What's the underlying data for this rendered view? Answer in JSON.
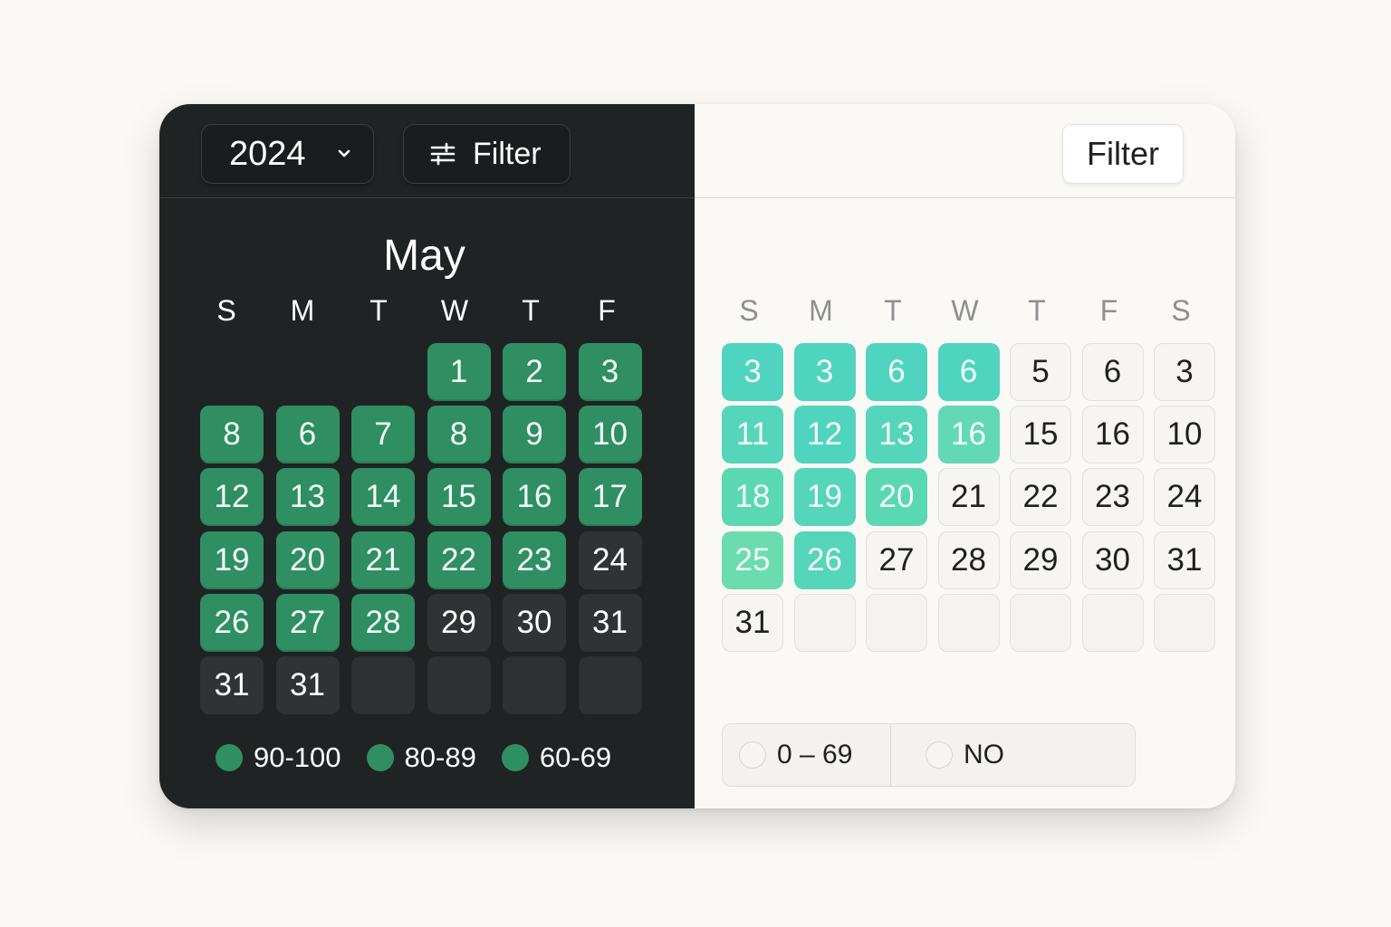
{
  "dark_panel": {
    "year_select": "2024",
    "filter_label": "Filter",
    "month_title": "May",
    "weekday_headers": [
      "S",
      "M",
      "T",
      "W",
      "T",
      "F"
    ],
    "rows": [
      [
        null,
        null,
        null,
        {
          "v": "1",
          "t": "green"
        },
        {
          "v": "2",
          "t": "green"
        },
        {
          "v": "3",
          "t": "green"
        }
      ],
      [
        {
          "v": "8",
          "t": "green"
        },
        {
          "v": "6",
          "t": "green"
        },
        {
          "v": "7",
          "t": "green"
        },
        {
          "v": "8",
          "t": "green"
        },
        {
          "v": "9",
          "t": "green"
        },
        {
          "v": "10",
          "t": "green"
        }
      ],
      [
        {
          "v": "12",
          "t": "green"
        },
        {
          "v": "13",
          "t": "green"
        },
        {
          "v": "14",
          "t": "green"
        },
        {
          "v": "15",
          "t": "green"
        },
        {
          "v": "16",
          "t": "green"
        },
        {
          "v": "17",
          "t": "green"
        }
      ],
      [
        {
          "v": "19",
          "t": "green"
        },
        {
          "v": "20",
          "t": "green"
        },
        {
          "v": "21",
          "t": "green"
        },
        {
          "v": "22",
          "t": "green"
        },
        {
          "v": "23",
          "t": "green"
        },
        {
          "v": "24",
          "t": "gray"
        }
      ],
      [
        {
          "v": "26",
          "t": "green"
        },
        {
          "v": "27",
          "t": "green"
        },
        {
          "v": "28",
          "t": "green"
        },
        {
          "v": "29",
          "t": "gray"
        },
        {
          "v": "30",
          "t": "gray"
        },
        {
          "v": "31",
          "t": "gray"
        }
      ],
      [
        {
          "v": "31",
          "t": "gray"
        },
        {
          "v": "31",
          "t": "gray"
        },
        {
          "v": "",
          "t": "empty"
        },
        {
          "v": "",
          "t": "empty"
        },
        {
          "v": "",
          "t": "empty"
        },
        {
          "v": "",
          "t": "empty"
        }
      ]
    ],
    "legend": [
      "90-100",
      "80-89",
      "60-69"
    ],
    "colors": {
      "high": "#2f8f62",
      "background": "#202324"
    }
  },
  "light_panel": {
    "filter_label": "Filter",
    "weekday_headers": [
      "S",
      "M",
      "T",
      "W",
      "T",
      "F",
      "S"
    ],
    "rows": [
      [
        {
          "v": "3",
          "t": "teal",
          "c": "#4fd4bf"
        },
        {
          "v": "3",
          "t": "teal",
          "c": "#4fd4bf"
        },
        {
          "v": "6",
          "t": "teal",
          "c": "#4fd4bf"
        },
        {
          "v": "6",
          "t": "teal",
          "c": "#4fd4bf"
        },
        {
          "v": "5",
          "t": "white"
        },
        {
          "v": "6",
          "t": "white"
        },
        {
          "v": "3",
          "t": "white"
        }
      ],
      [
        {
          "v": "11",
          "t": "teal",
          "c": "#55d5b9"
        },
        {
          "v": "12",
          "t": "teal",
          "c": "#4fd4bf"
        },
        {
          "v": "13",
          "t": "teal",
          "c": "#55d5b9"
        },
        {
          "v": "16",
          "t": "teal",
          "c": "#62d9b4"
        },
        {
          "v": "15",
          "t": "white"
        },
        {
          "v": "16",
          "t": "white"
        },
        {
          "v": "10",
          "t": "white"
        }
      ],
      [
        {
          "v": "18",
          "t": "teal",
          "c": "#5ad8b2"
        },
        {
          "v": "19",
          "t": "teal",
          "c": "#55d5b9"
        },
        {
          "v": "20",
          "t": "teal",
          "c": "#5ad8b2"
        },
        {
          "v": "21",
          "t": "white"
        },
        {
          "v": "22",
          "t": "white"
        },
        {
          "v": "23",
          "t": "white"
        },
        {
          "v": "24",
          "t": "white"
        }
      ],
      [
        {
          "v": "25",
          "t": "teal",
          "c": "#6adcb0"
        },
        {
          "v": "26",
          "t": "teal",
          "c": "#55d5b9"
        },
        {
          "v": "27",
          "t": "white"
        },
        {
          "v": "28",
          "t": "white"
        },
        {
          "v": "29",
          "t": "white"
        },
        {
          "v": "30",
          "t": "white"
        },
        {
          "v": "31",
          "t": "white"
        }
      ],
      [
        {
          "v": "31",
          "t": "white"
        },
        {
          "v": "",
          "t": "empty"
        },
        {
          "v": "",
          "t": "empty"
        },
        {
          "v": "",
          "t": "empty"
        },
        {
          "v": "",
          "t": "empty"
        },
        {
          "v": "",
          "t": "empty"
        },
        {
          "v": "",
          "t": "empty"
        }
      ]
    ],
    "legend": [
      "0 – 69",
      "NO"
    ]
  }
}
